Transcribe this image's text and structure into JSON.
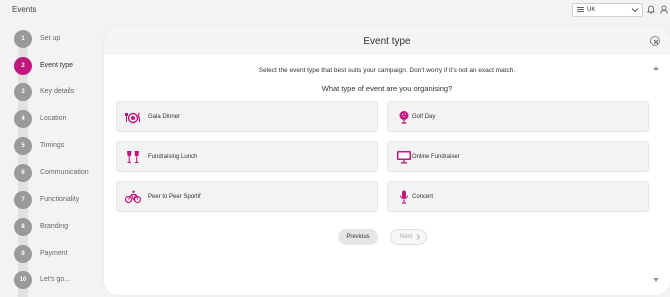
{
  "app": {
    "title": "Events"
  },
  "header": {
    "region": "UK"
  },
  "steps": [
    {
      "number": "1",
      "label": "Set up"
    },
    {
      "number": "2",
      "label": "Event type"
    },
    {
      "number": "3",
      "label": "Key details"
    },
    {
      "number": "4",
      "label": "Location"
    },
    {
      "number": "5",
      "label": "Timings"
    },
    {
      "number": "6",
      "label": "Communication"
    },
    {
      "number": "7",
      "label": "Functionality"
    },
    {
      "number": "8",
      "label": "Branding"
    },
    {
      "number": "9",
      "label": "Payment"
    },
    {
      "number": "10",
      "label": "Let's go..."
    }
  ],
  "active_step": 2,
  "panel": {
    "title": "Event type",
    "intro": "Select the event type that best suits your campaign. Don't worry if it's not an exact match.",
    "question": "What type of event are you organising?"
  },
  "event_types": [
    {
      "label": "Gala Dinner",
      "icon": "dinner-icon"
    },
    {
      "label": "Golf Day",
      "icon": "golf-icon"
    },
    {
      "label": "Fundraising Lunch",
      "icon": "glasses-icon"
    },
    {
      "label": "Online Fundraiser",
      "icon": "monitor-icon"
    },
    {
      "label": "Peer to Peer Sportif",
      "icon": "bike-icon"
    },
    {
      "label": "Concert",
      "icon": "microphone-icon"
    }
  ],
  "nav": {
    "previous": "Previous",
    "next": "Next"
  },
  "colors": {
    "accent": "#c1187f",
    "step_inactive": "#9a9a9a"
  }
}
